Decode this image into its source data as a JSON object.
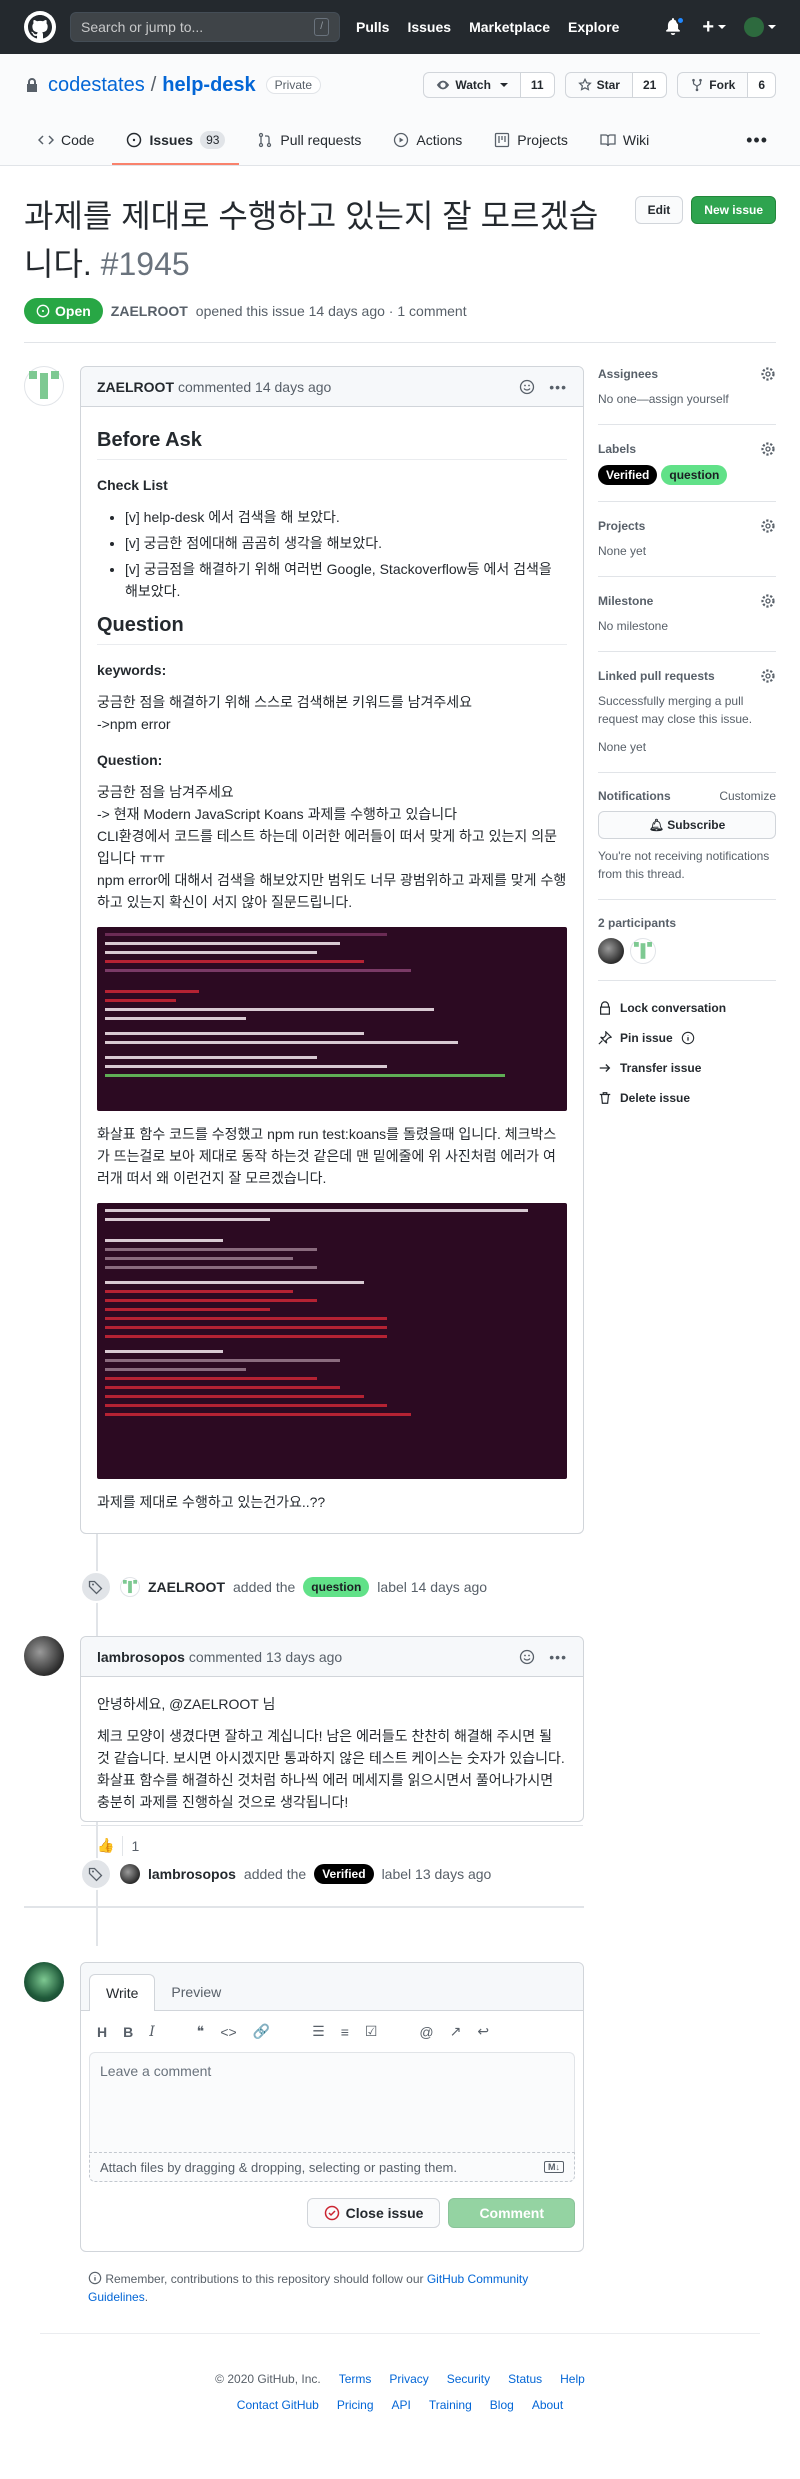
{
  "header": {
    "search_placeholder": "Search or jump to...",
    "slash": "/",
    "nav": [
      "Pulls",
      "Issues",
      "Marketplace",
      "Explore"
    ],
    "plus": "+"
  },
  "repo": {
    "owner": "codestates",
    "separator": "/",
    "name": "help-desk",
    "visibility": "Private",
    "watch_label": "Watch",
    "watch_count": "11",
    "star_label": "Star",
    "star_count": "21",
    "fork_label": "Fork",
    "fork_count": "6",
    "tabs": [
      {
        "label": "Code",
        "icon": "code-icon"
      },
      {
        "label": "Issues",
        "icon": "issue-icon",
        "count": "93"
      },
      {
        "label": "Pull requests",
        "icon": "pull-request-icon"
      },
      {
        "label": "Actions",
        "icon": "play-icon"
      },
      {
        "label": "Projects",
        "icon": "project-icon"
      },
      {
        "label": "Wiki",
        "icon": "book-icon"
      }
    ]
  },
  "issue": {
    "title": "과제를 제대로 수행하고 있는지 잘 모르겠습니다.",
    "number": "#1945",
    "edit_label": "Edit",
    "new_issue_label": "New issue",
    "state": "Open",
    "author": "ZAELROOT",
    "opened_text": "opened this issue 14 days ago · 1 comment"
  },
  "first_comment": {
    "author": "ZAELROOT",
    "time": "commented 14 days ago",
    "h_before": "Before Ask",
    "h_checklist": "Check List",
    "checklist": [
      "[v] help-desk 에서 검색을 해 보았다.",
      "[v] 궁금한 점에대해 곰곰히 생각을 해보았다.",
      "[v] 궁금점을 해결하기 위해 여러번 Google, Stackoverflow등 에서 검색을 해보았다."
    ],
    "h_question": "Question",
    "h_keywords": "keywords:",
    "keywords_line1": "궁금한 점을 해결하기 위해 스스로 검색해본 키워드를 남겨주세요",
    "keywords_line2": "->npm error",
    "h_question2": "Question:",
    "q_line1": "궁금한 점을 남겨주세요",
    "q_line2": "-> 현재 Modern JavaScript Koans 과제를 수행하고 있습니다",
    "q_line3": "CLI환경에서 코드를 테스트 하는데 이러한 에러들이 떠서 맞게 하고 있는지 의문입니다 ㅠㅠ",
    "q_line4": "npm error에 대해서 검색을 해보았지만 범위도 너무 광범위하고 과제를 맞게 수행하고 있는지 확신이 서지 않아 질문드립니다.",
    "after_image": "화살표 함수 코드를 수정했고 npm run test:koans를 돌렸을때 입니다. 체크박스가 뜨는걸로 보아 제대로 동작 하는것 같은데 맨 밑에줄에 위 사진처럼 에러가 여러개 떠서 왜 이런건지 잘 모르겠습니다.",
    "closing": "과제를 제대로 수행하고 있는건가요..??"
  },
  "event1": {
    "actor": "ZAELROOT",
    "action": "added the",
    "label": "question",
    "suffix": "label 14 days ago"
  },
  "second_comment": {
    "author": "lambrosopos",
    "time": "commented 13 days ago",
    "greeting": "안녕하세요, @ZAELROOT 님",
    "body": "체크 모양이 생겼다면 잘하고 계십니다! 남은 에러들도 찬찬히 해결해 주시면 될 것 같습니다. 보시면 아시겠지만 통과하지 않은 테스트 케이스는 숫자가 있습니다. 화살표 함수를 해결하신 것처럼 하나씩 에러 메세지를 읽으시면서 풀어나가시면 충분히 과제를 진행하실 것으로 생각됩니다!",
    "reaction_emoji": "👍",
    "reaction_count": "1"
  },
  "event2": {
    "actor": "lambrosopos",
    "action": "added the",
    "label": "Verified",
    "suffix": "label 13 days ago"
  },
  "composer": {
    "tab_write": "Write",
    "tab_preview": "Preview",
    "placeholder": "Leave a comment",
    "attach": "Attach files by dragging & dropping, selecting or pasting them.",
    "close_label": "Close issue",
    "comment_label": "Comment",
    "remember_prefix": "Remember, contributions to this repository should follow our",
    "remember_link": "GitHub Community Guidelines",
    "remember_suffix": "."
  },
  "sidebar": {
    "assignees_h": "Assignees",
    "assignees_t": "No one—assign yourself",
    "labels_h": "Labels",
    "labels": [
      "Verified",
      "question"
    ],
    "projects_h": "Projects",
    "projects_t": "None yet",
    "milestone_h": "Milestone",
    "milestone_t": "No milestone",
    "linked_h": "Linked pull requests",
    "linked_t": "Successfully merging a pull request may close this issue.",
    "linked_none": "None yet",
    "notif_h": "Notifications",
    "customize": "Customize",
    "subscribe": "Subscribe",
    "notif_t": "You're not receiving notifications from this thread.",
    "participants_h": "2 participants",
    "lock": "Lock conversation",
    "pin": "Pin issue",
    "transfer": "Transfer issue",
    "delete": "Delete issue"
  },
  "footer": {
    "copyright": "© 2020 GitHub, Inc.",
    "row1": [
      "Terms",
      "Privacy",
      "Security",
      "Status",
      "Help"
    ],
    "row2": [
      "Contact GitHub",
      "Pricing",
      "API",
      "Training",
      "Blog",
      "About"
    ]
  },
  "colors": {
    "accent": "#0366d6",
    "open": "#28a745",
    "header": "#24292e",
    "question_label": "#61e188",
    "verified_label": "#000000"
  }
}
